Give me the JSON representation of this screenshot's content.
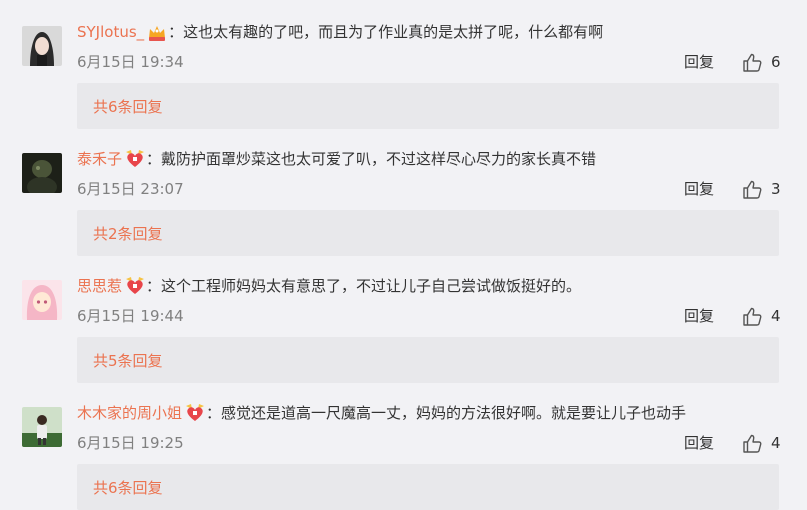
{
  "comments": [
    {
      "username": "SYJlotus_",
      "badge": "crown-badge-icon",
      "content": "：这也太有趣的了吧，而且为了作业真的是太拼了呢，什么都有啊",
      "time": "6月15日 19:34",
      "reply_label": "回复",
      "likes": "6",
      "replies_label": "共6条回复",
      "avatar_colors": [
        "#d9d9d9",
        "#2b2b2b",
        "#f1ddd2"
      ]
    },
    {
      "username": "泰禾子",
      "badge": "heart-badge-icon",
      "content": "：戴防护面罩炒菜这也太可爱了叭，不过这样尽心尽力的家长真不错",
      "time": "6月15日 23:07",
      "reply_label": "回复",
      "likes": "3",
      "replies_label": "共2条回复",
      "avatar_colors": [
        "#1d2018",
        "#4a5438",
        "#7e8a63"
      ]
    },
    {
      "username": "思思惹",
      "badge": "heart-badge-icon",
      "content": "：这个工程师妈妈太有意思了，不过让儿子自己尝试做饭挺好的。",
      "time": "6月15日 19:44",
      "reply_label": "回复",
      "likes": "4",
      "replies_label": "共5条回复",
      "avatar_colors": [
        "#fbe4ea",
        "#f5b6c6",
        "#ffe9d6"
      ]
    },
    {
      "username": "木木家的周小姐",
      "badge": "heart-badge-icon",
      "content": "：感觉还是道高一尺魔高一丈，妈妈的方法很好啊。就是要让儿子也动手",
      "time": "6月15日 19:25",
      "reply_label": "回复",
      "likes": "4",
      "replies_label": "共6条回复",
      "avatar_colors": [
        "#cfe0c9",
        "#3d6b34",
        "#eeeeee"
      ]
    }
  ],
  "colors": {
    "background": "#f2f2f5",
    "username": "#eb7350",
    "replies_box": "#e8e8eb",
    "meta_text": "#808080"
  }
}
